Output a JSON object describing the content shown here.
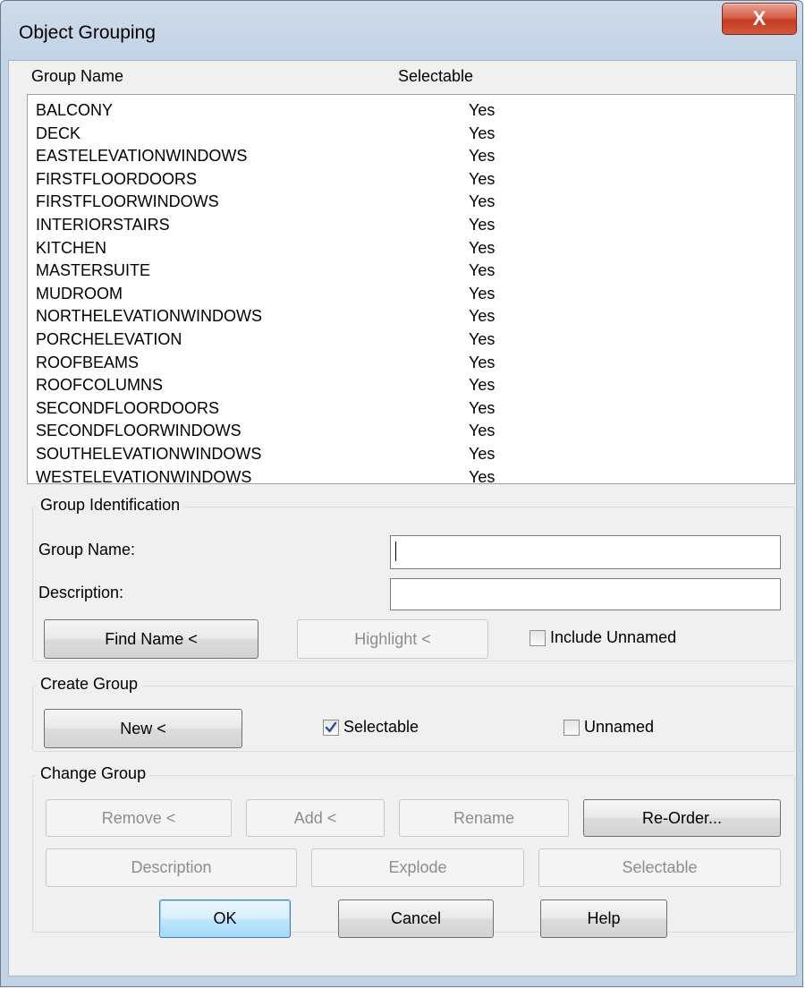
{
  "window": {
    "title": "Object Grouping",
    "close_glyph": "X"
  },
  "list": {
    "headers": {
      "name": "Group Name",
      "selectable": "Selectable"
    },
    "rows": [
      {
        "name": "BALCONY",
        "selectable": "Yes"
      },
      {
        "name": "DECK",
        "selectable": "Yes"
      },
      {
        "name": "EASTELEVATIONWINDOWS",
        "selectable": "Yes"
      },
      {
        "name": "FIRSTFLOORDOORS",
        "selectable": "Yes"
      },
      {
        "name": "FIRSTFLOORWINDOWS",
        "selectable": "Yes"
      },
      {
        "name": "INTERIORSTAIRS",
        "selectable": "Yes"
      },
      {
        "name": "KITCHEN",
        "selectable": "Yes"
      },
      {
        "name": "MASTERSUITE",
        "selectable": "Yes"
      },
      {
        "name": "MUDROOM",
        "selectable": "Yes"
      },
      {
        "name": "NORTHELEVATIONWINDOWS",
        "selectable": "Yes"
      },
      {
        "name": "PORCHELEVATION",
        "selectable": "Yes"
      },
      {
        "name": "ROOFBEAMS",
        "selectable": "Yes"
      },
      {
        "name": "ROOFCOLUMNS",
        "selectable": "Yes"
      },
      {
        "name": "SECONDFLOORDOORS",
        "selectable": "Yes"
      },
      {
        "name": "SECONDFLOORWINDOWS",
        "selectable": "Yes"
      },
      {
        "name": "SOUTHELEVATIONWINDOWS",
        "selectable": "Yes"
      },
      {
        "name": "WESTELEVATIONWINDOWS",
        "selectable": "Yes"
      }
    ]
  },
  "group_identification": {
    "title": "Group Identification",
    "group_name_label": "Group Name:",
    "group_name_value": "",
    "description_label": "Description:",
    "description_value": "",
    "find_name_button": "Find Name <",
    "highlight_button": "Highlight <",
    "include_unnamed_label": "Include Unnamed",
    "include_unnamed_checked": false
  },
  "create_group": {
    "title": "Create Group",
    "new_button": "New <",
    "selectable_label": "Selectable",
    "selectable_checked": true,
    "unnamed_label": "Unnamed",
    "unnamed_checked": false
  },
  "change_group": {
    "title": "Change Group",
    "remove_button": "Remove <",
    "add_button": "Add <",
    "rename_button": "Rename",
    "reorder_button": "Re-Order...",
    "description_button": "Description",
    "explode_button": "Explode",
    "selectable_button": "Selectable"
  },
  "footer": {
    "ok_button": "OK",
    "cancel_button": "Cancel",
    "help_button": "Help"
  }
}
